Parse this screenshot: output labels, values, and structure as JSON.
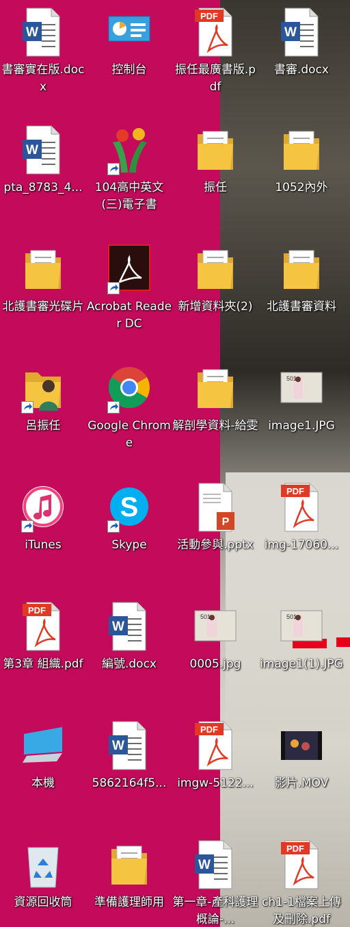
{
  "desktop": {
    "colors": {
      "wallpaper_left": "#c30a5b",
      "label": "#ffffff",
      "word_blue": "#2b579a",
      "pdf_red": "#e03a26",
      "folder": "#f5c542"
    },
    "icons": [
      {
        "label": "書審實在版.docx",
        "icon": "word-doc-icon"
      },
      {
        "label": "控制台",
        "icon": "control-panel-icon"
      },
      {
        "label": "振任最廣書版.pdf",
        "icon": "pdf-icon"
      },
      {
        "label": "書審.docx",
        "icon": "word-doc-icon"
      },
      {
        "label": "pta_8783_4...",
        "icon": "word-doc-icon"
      },
      {
        "label": "104高中英文(三)電子書",
        "icon": "app-shortcut-icon"
      },
      {
        "label": "振任",
        "icon": "folder-icon"
      },
      {
        "label": "1052內外",
        "icon": "folder-icon"
      },
      {
        "label": "北護書審光碟片",
        "icon": "folder-icon"
      },
      {
        "label": "Acrobat Reader DC",
        "icon": "acrobat-icon"
      },
      {
        "label": "新增資料夾(2)",
        "icon": "folder-icon"
      },
      {
        "label": "北護書審資料",
        "icon": "folder-icon"
      },
      {
        "label": "呂振任",
        "icon": "user-folder-icon"
      },
      {
        "label": "Google Chrome",
        "icon": "chrome-icon"
      },
      {
        "label": "解剖學資料-給雯",
        "icon": "folder-icon"
      },
      {
        "label": "image1.JPG",
        "icon": "image-icon"
      },
      {
        "label": "iTunes",
        "icon": "itunes-icon"
      },
      {
        "label": "Skype",
        "icon": "skype-icon"
      },
      {
        "label": "活動參與.pptx",
        "icon": "pptx-icon"
      },
      {
        "label": "img-17060...",
        "icon": "pdf-icon"
      },
      {
        "label": "第3章 組織.pdf",
        "icon": "pdf-icon"
      },
      {
        "label": "編號.docx",
        "icon": "word-doc-icon"
      },
      {
        "label": "0005.jpg",
        "icon": "image-icon"
      },
      {
        "label": "image1(1).JPG",
        "icon": "image-icon"
      },
      {
        "label": "本機",
        "icon": "computer-icon"
      },
      {
        "label": "5862164f5...",
        "icon": "word-doc-icon"
      },
      {
        "label": "imgw-5122...",
        "icon": "pdf-icon"
      },
      {
        "label": "影片.MOV",
        "icon": "video-icon"
      },
      {
        "label": "資源回收筒",
        "icon": "recycle-bin-icon"
      },
      {
        "label": "準備護理師用",
        "icon": "folder-icon"
      },
      {
        "label": "第一章-產科護理概論-...",
        "icon": "word-doc-icon"
      },
      {
        "label": "ch1-1檔案上傳及刪除.pdf",
        "icon": "pdf-icon"
      }
    ],
    "badges": {
      "pdf": "PDF",
      "word": "W",
      "image_text": "501"
    }
  }
}
